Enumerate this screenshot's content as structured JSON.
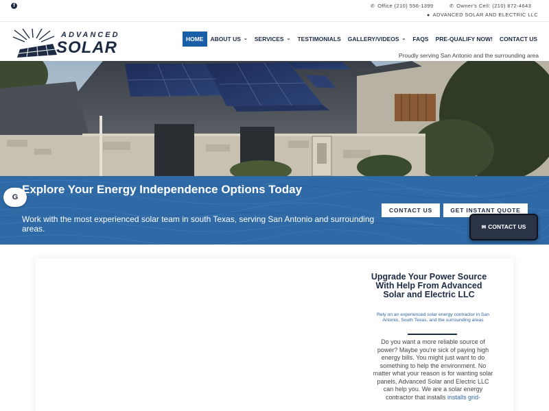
{
  "topbar": {
    "facebook_icon": "facebook-icon",
    "office": "Office (210) 556-1399",
    "owner": "Owner's Cell: (210) 872-4643",
    "company": "ADVANCED SOLAR AND ELECTRIC LLC"
  },
  "logo": {
    "top": "ADVANCED",
    "bottom": "SOLAR"
  },
  "nav": {
    "items": [
      {
        "label": "HOME",
        "active": true
      },
      {
        "label": "ABOUT US",
        "dropdown": true
      },
      {
        "label": "SERVICES",
        "dropdown": true
      },
      {
        "label": "TESTIMONIALS"
      },
      {
        "label": "GALLERY/VIDEOS",
        "dropdown": true
      },
      {
        "label": "FAQS"
      },
      {
        "label": "PRE-QUALIFY NOW!"
      },
      {
        "label": "CONTACT US"
      }
    ]
  },
  "header": {
    "serving": "Proudly serving San Antonio and the surrounding area"
  },
  "banner": {
    "title": "Explore Your Energy Independence Options Today",
    "subtitle": "Work with the most experienced solar team in south Texas, serving San Antonio and surrounding areas.",
    "contact_btn": "CONTACT US",
    "quote_btn": "GET INSTANT QUOTE",
    "g_btn": "G"
  },
  "floating": {
    "contact_label": "CONTACT US"
  },
  "content": {
    "title": "Upgrade Your Power Source With Help From Advanced Solar and Electric LLC",
    "subtitle": "Rely on an experienced solar energy contractor in San Antonio, South Texas, and the surrounding areas",
    "body": "Do you want a more reliable source of power? Maybe you're sick of paying high energy bills. You might just want to do something to help the environment. No matter what your reason is for wanting solar panels, Advanced Solar and Electric LLC can help you. We are a solar energy contractor that installs",
    "body_link": "installs grid-"
  },
  "colors": {
    "navy": "#1c2a44",
    "accent_blue": "#1a5ea8",
    "banner_blue": "#2f6aa7"
  }
}
